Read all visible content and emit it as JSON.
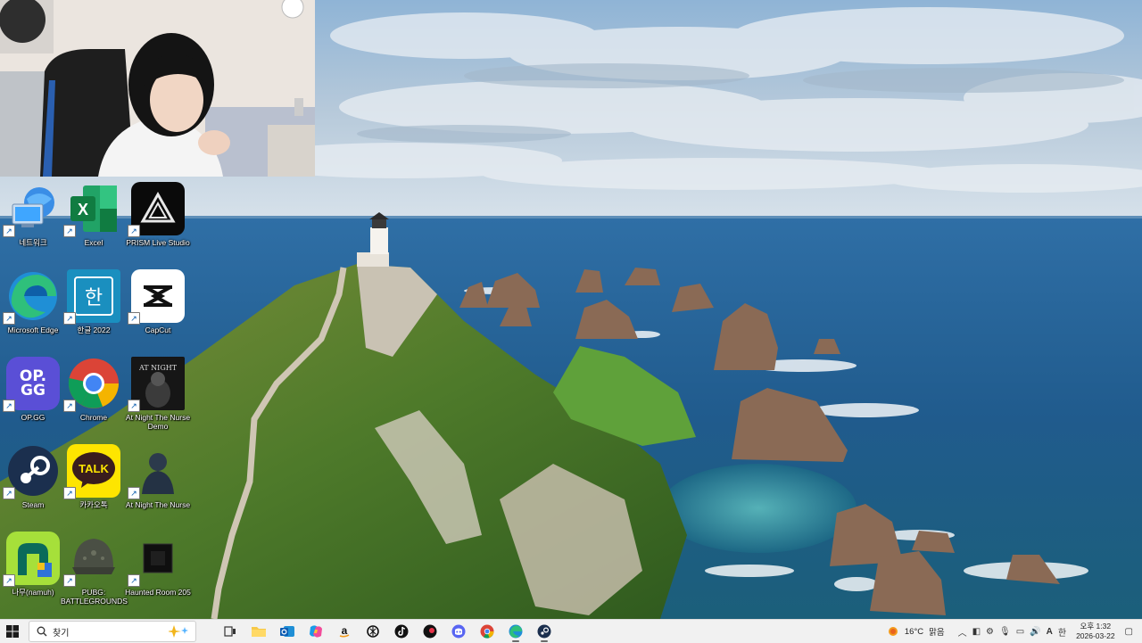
{
  "desktop": {
    "icons": [
      {
        "label": "네트워크",
        "icon": "network-icon"
      },
      {
        "label": "Excel",
        "icon": "excel-icon"
      },
      {
        "label": "PRISM Live Studio",
        "icon": "prism-icon"
      },
      {
        "label": "Microsoft Edge",
        "icon": "edge-icon"
      },
      {
        "label": "한글 2022",
        "icon": "hangul-icon",
        "glyph": "한"
      },
      {
        "label": "CapCut",
        "icon": "capcut-icon"
      },
      {
        "label": "OP.GG",
        "icon": "opgg-icon",
        "glyph": "OP.\nGG"
      },
      {
        "label": "Chrome",
        "icon": "chrome-icon"
      },
      {
        "label": "At Night The Nurse Demo",
        "icon": "at-night-icon",
        "glyph": "AT NIGHT"
      },
      {
        "label": "Steam",
        "icon": "steam-icon"
      },
      {
        "label": "카카오톡",
        "icon": "kakaotalk-icon",
        "glyph": "TALK"
      },
      {
        "label": "At Night The Nurse",
        "icon": "nurse-icon"
      },
      {
        "label": "나무(namuh)",
        "icon": "namuh-icon"
      },
      {
        "label": "PUBG: BATTLEGROUNDS",
        "icon": "pubg-icon"
      },
      {
        "label": "Haunted Room 205",
        "icon": "haunted-room-icon"
      }
    ]
  },
  "taskbar": {
    "search_placeholder": "찾기",
    "apps": [
      "task-view-icon",
      "file-explorer-icon",
      "outlook-icon",
      "copilot-icon",
      "amazon-icon",
      "chatgpt-icon",
      "tiktok-icon",
      "prism-icon",
      "discord-icon",
      "chrome-icon",
      "edge-icon",
      "steam-icon"
    ],
    "weather": {
      "temp": "16°C",
      "condition": "맑음"
    },
    "clock": {
      "time": "오후 1:32",
      "date": "2026-03-22"
    },
    "tray": {
      "ime": "A",
      "lang": "한"
    }
  },
  "colors": {
    "taskbar_bg": "#f1f1f1",
    "excel": "#1f7a45",
    "opgg": "#5a4fd6",
    "kakao": "#fee500",
    "capcut": "#ffffff"
  }
}
